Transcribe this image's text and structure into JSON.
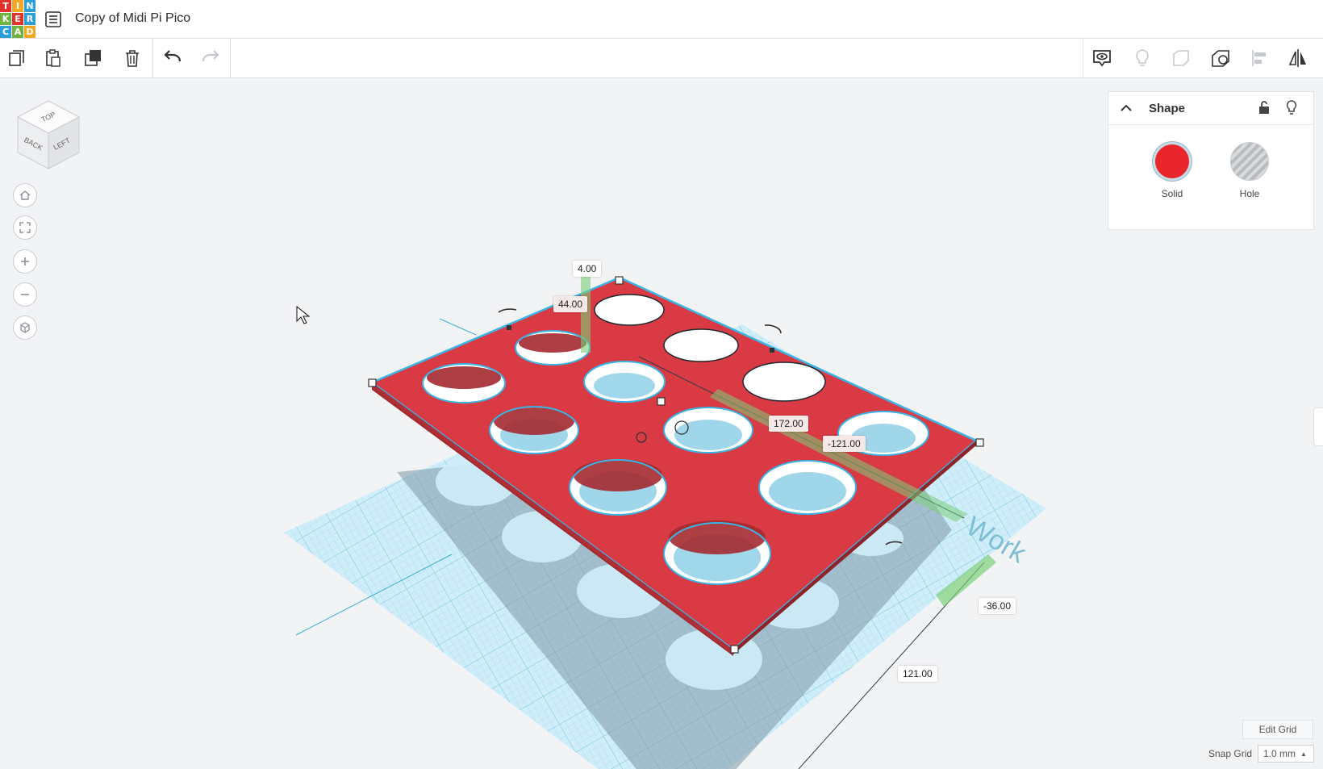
{
  "header": {
    "logo_letters": [
      "T",
      "I",
      "N",
      "K",
      "E",
      "R",
      "C",
      "A",
      "D"
    ],
    "title": "Copy of Midi Pi Pico"
  },
  "toolbar": {
    "left_tools": [
      "copy-icon",
      "paste-icon",
      "duplicate-icon",
      "delete-icon",
      "undo-icon",
      "redo-icon"
    ],
    "right_tools": [
      "show-notes-icon",
      "light-icon",
      "shapes-icon",
      "workplane-icon",
      "align-icon",
      "mirror-icon"
    ]
  },
  "navcube": {
    "top": "TOP",
    "back": "BACK",
    "left": "LEFT"
  },
  "nav_controls": [
    "home-view-icon",
    "fit-view-icon",
    "zoom-in-icon",
    "zoom-out-icon",
    "perspective-icon"
  ],
  "inspector": {
    "title": "Shape",
    "solid_label": "Solid",
    "hole_label": "Hole",
    "solid_color": "#e8262c"
  },
  "dimensions": {
    "height": "4.00",
    "elevation": "44.00",
    "length": "172.00",
    "offset_x": "-121.00",
    "offset_y": "-36.00",
    "width": "121.00"
  },
  "workplane_text": "Work",
  "footer": {
    "edit_grid": "Edit Grid",
    "snap_grid_label": "Snap Grid",
    "snap_grid_value": "1.0 mm"
  },
  "colors": {
    "shape_red": "#d93a43",
    "selection_outline": "#3bb4e6",
    "grid": "#a9dced"
  }
}
